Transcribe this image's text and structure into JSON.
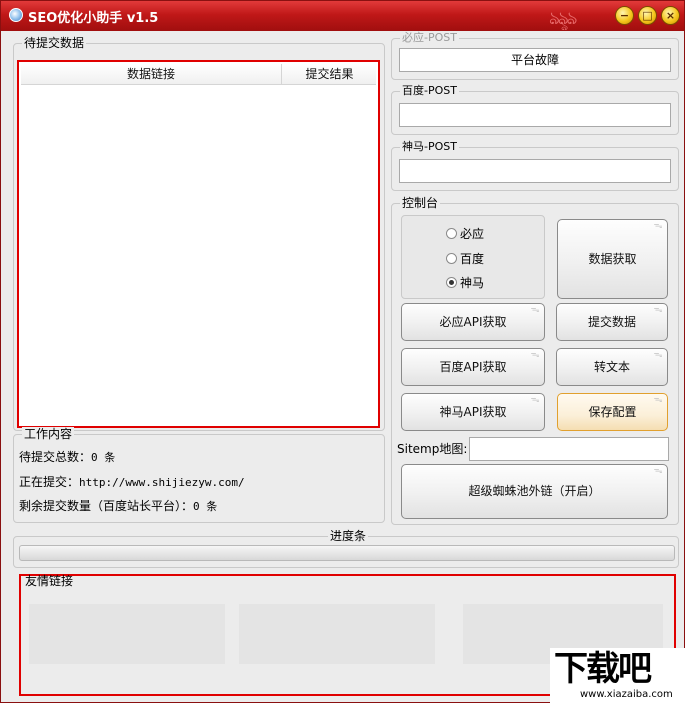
{
  "window": {
    "title": "SEO优化小助手 v1.5",
    "swirl": "ঌৡঌ",
    "min": "−",
    "max": "□",
    "close": "×"
  },
  "pending": {
    "group_title": "待提交数据",
    "columns": [
      "数据链接",
      "提交结果"
    ],
    "rows": []
  },
  "bing": {
    "group_title": "必应-POST",
    "value": "平台故障"
  },
  "baidu": {
    "group_title": "百度-POST",
    "value": ""
  },
  "shenma": {
    "group_title": "神马-POST",
    "value": ""
  },
  "console": {
    "group_title": "控制台",
    "radios": [
      {
        "label": "必应",
        "checked": false
      },
      {
        "label": "百度",
        "checked": false
      },
      {
        "label": "神马",
        "checked": true
      }
    ],
    "buttons": {
      "fetch_data": "数据获取",
      "bing_api": "必应API获取",
      "submit_data": "提交数据",
      "baidu_api": "百度API获取",
      "to_text": "转文本",
      "shenma_api": "神马API获取",
      "save_config": "保存配置",
      "spider_pool": "超级蜘蛛池外链（开启）"
    },
    "sitemap_label": "Sitemp地图:",
    "sitemap_value": ""
  },
  "work": {
    "group_title": "工作内容",
    "pending_total_label": "待提交总数：",
    "pending_total_value": "0 条",
    "submitting_label": "正在提交：",
    "submitting_url": "http://www.shijiezyw.com/",
    "remaining_label": "剩余提交数量（百度站长平台）：",
    "remaining_value": "0 条"
  },
  "progress": {
    "label": "进度条",
    "value": 0
  },
  "friend_links": {
    "group_title": "友情链接"
  },
  "watermark": {
    "big": "下载吧",
    "small": "www.xiazaiba.com"
  }
}
